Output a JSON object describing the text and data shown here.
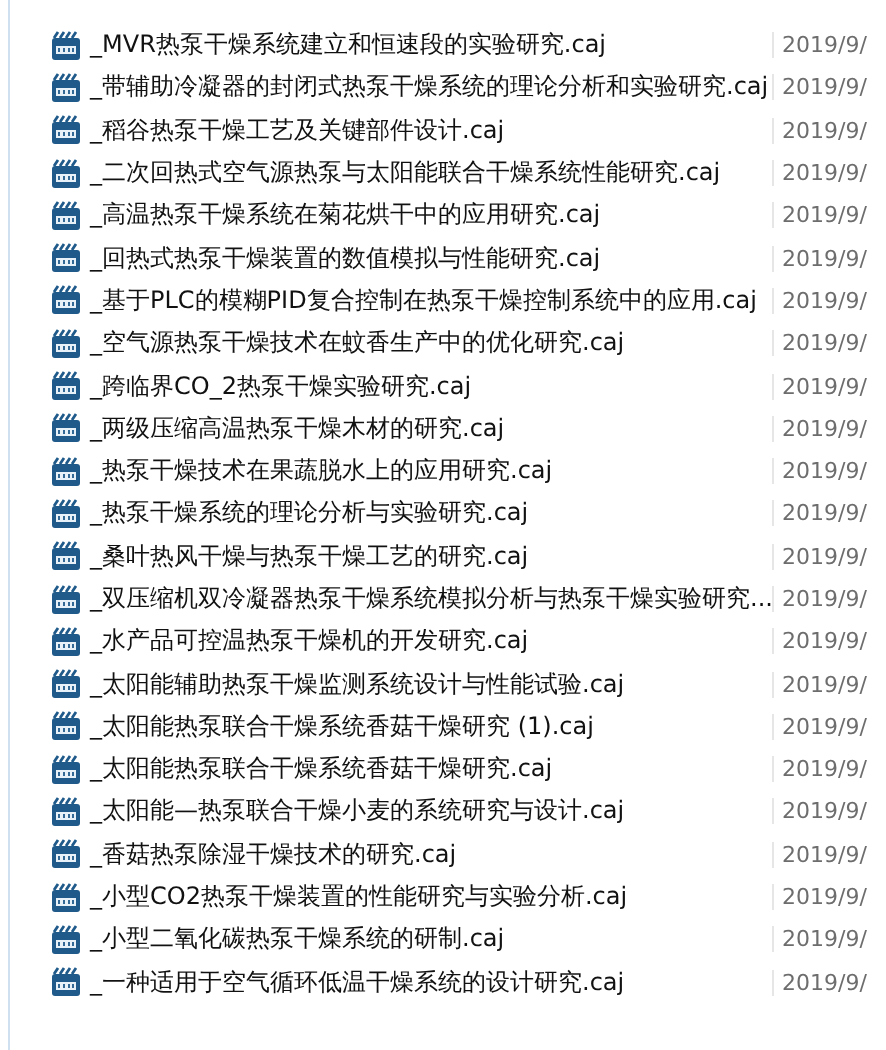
{
  "files": [
    {
      "name": "_MVR热泵干燥系统建立和恒速段的实验研究.caj",
      "date": "2019/9/"
    },
    {
      "name": "_带辅助冷凝器的封闭式热泵干燥系统的理论分析和实验研究.caj",
      "date": "2019/9/"
    },
    {
      "name": "_稻谷热泵干燥工艺及关键部件设计.caj",
      "date": "2019/9/"
    },
    {
      "name": "_二次回热式空气源热泵与太阳能联合干燥系统性能研究.caj",
      "date": "2019/9/"
    },
    {
      "name": "_高温热泵干燥系统在菊花烘干中的应用研究.caj",
      "date": "2019/9/"
    },
    {
      "name": "_回热式热泵干燥装置的数值模拟与性能研究.caj",
      "date": "2019/9/"
    },
    {
      "name": "_基于PLC的模糊PID复合控制在热泵干燥控制系统中的应用.caj",
      "date": "2019/9/"
    },
    {
      "name": "_空气源热泵干燥技术在蚊香生产中的优化研究.caj",
      "date": "2019/9/"
    },
    {
      "name": "_跨临界CO_2热泵干燥实验研究.caj",
      "date": "2019/9/"
    },
    {
      "name": "_两级压缩高温热泵干燥木材的研究.caj",
      "date": "2019/9/"
    },
    {
      "name": "_热泵干燥技术在果蔬脱水上的应用研究.caj",
      "date": "2019/9/"
    },
    {
      "name": "_热泵干燥系统的理论分析与实验研究.caj",
      "date": "2019/9/"
    },
    {
      "name": "_桑叶热风干燥与热泵干燥工艺的研究.caj",
      "date": "2019/9/"
    },
    {
      "name": "_双压缩机双冷凝器热泵干燥系统模拟分析与热泵干燥实验研究...",
      "date": "2019/9/"
    },
    {
      "name": "_水产品可控温热泵干燥机的开发研究.caj",
      "date": "2019/9/"
    },
    {
      "name": "_太阳能辅助热泵干燥监测系统设计与性能试验.caj",
      "date": "2019/9/"
    },
    {
      "name": "_太阳能热泵联合干燥系统香菇干燥研究 (1).caj",
      "date": "2019/9/"
    },
    {
      "name": "_太阳能热泵联合干燥系统香菇干燥研究.caj",
      "date": "2019/9/"
    },
    {
      "name": "_太阳能—热泵联合干燥小麦的系统研究与设计.caj",
      "date": "2019/9/"
    },
    {
      "name": "_香菇热泵除湿干燥技术的研究.caj",
      "date": "2019/9/"
    },
    {
      "name": "_小型CO2热泵干燥装置的性能研究与实验分析.caj",
      "date": "2019/9/"
    },
    {
      "name": "_小型二氧化碳热泵干燥系统的研制.caj",
      "date": "2019/9/"
    },
    {
      "name": "_一种适用于空气循环低温干燥系统的设计研究.caj",
      "date": "2019/9/"
    }
  ]
}
